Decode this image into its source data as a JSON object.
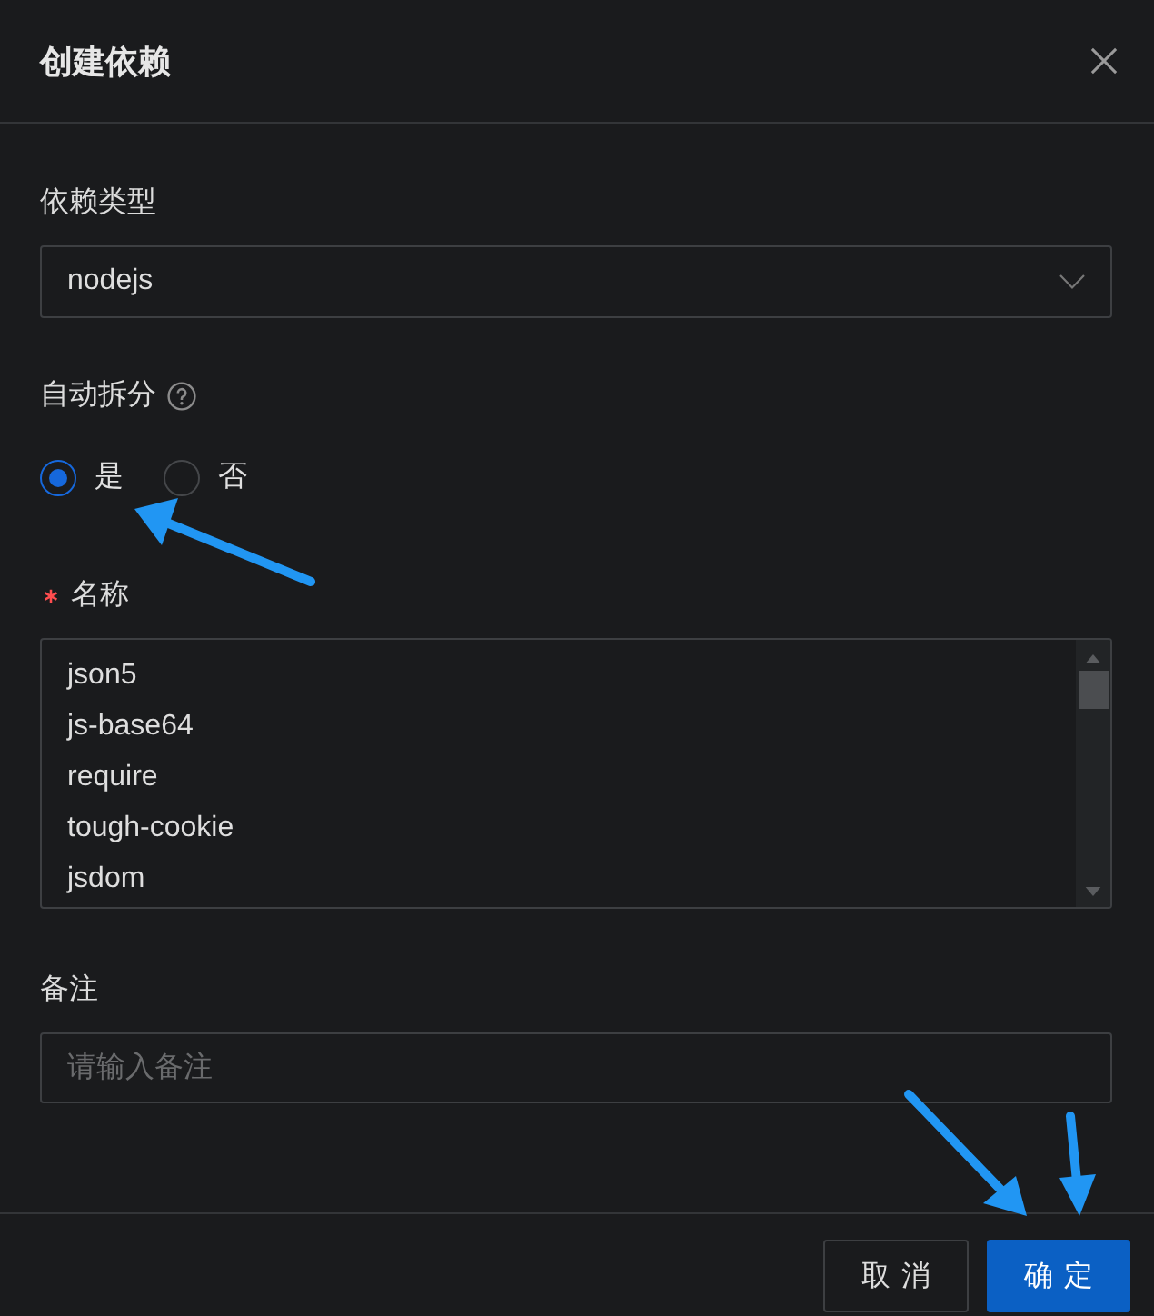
{
  "dialog": {
    "title": "创建依赖"
  },
  "fields": [
    {
      "kind": "select",
      "label": "依赖类型",
      "required": false,
      "value": "nodejs"
    },
    {
      "kind": "radio",
      "label": "自动拆分",
      "required": false,
      "help": true,
      "options": [
        {
          "label": "是",
          "selected": true
        },
        {
          "label": "否",
          "selected": false
        }
      ]
    },
    {
      "kind": "textarea",
      "label": "名称",
      "required": true,
      "lines": [
        "json5",
        "js-base64",
        "require",
        "tough-cookie",
        "jsdom"
      ]
    },
    {
      "kind": "input",
      "label": "备注",
      "required": false,
      "placeholder": "请输入备注"
    }
  ],
  "buttons": [
    {
      "label": "取消",
      "kind": "default"
    },
    {
      "label": "确定",
      "kind": "primary"
    }
  ]
}
